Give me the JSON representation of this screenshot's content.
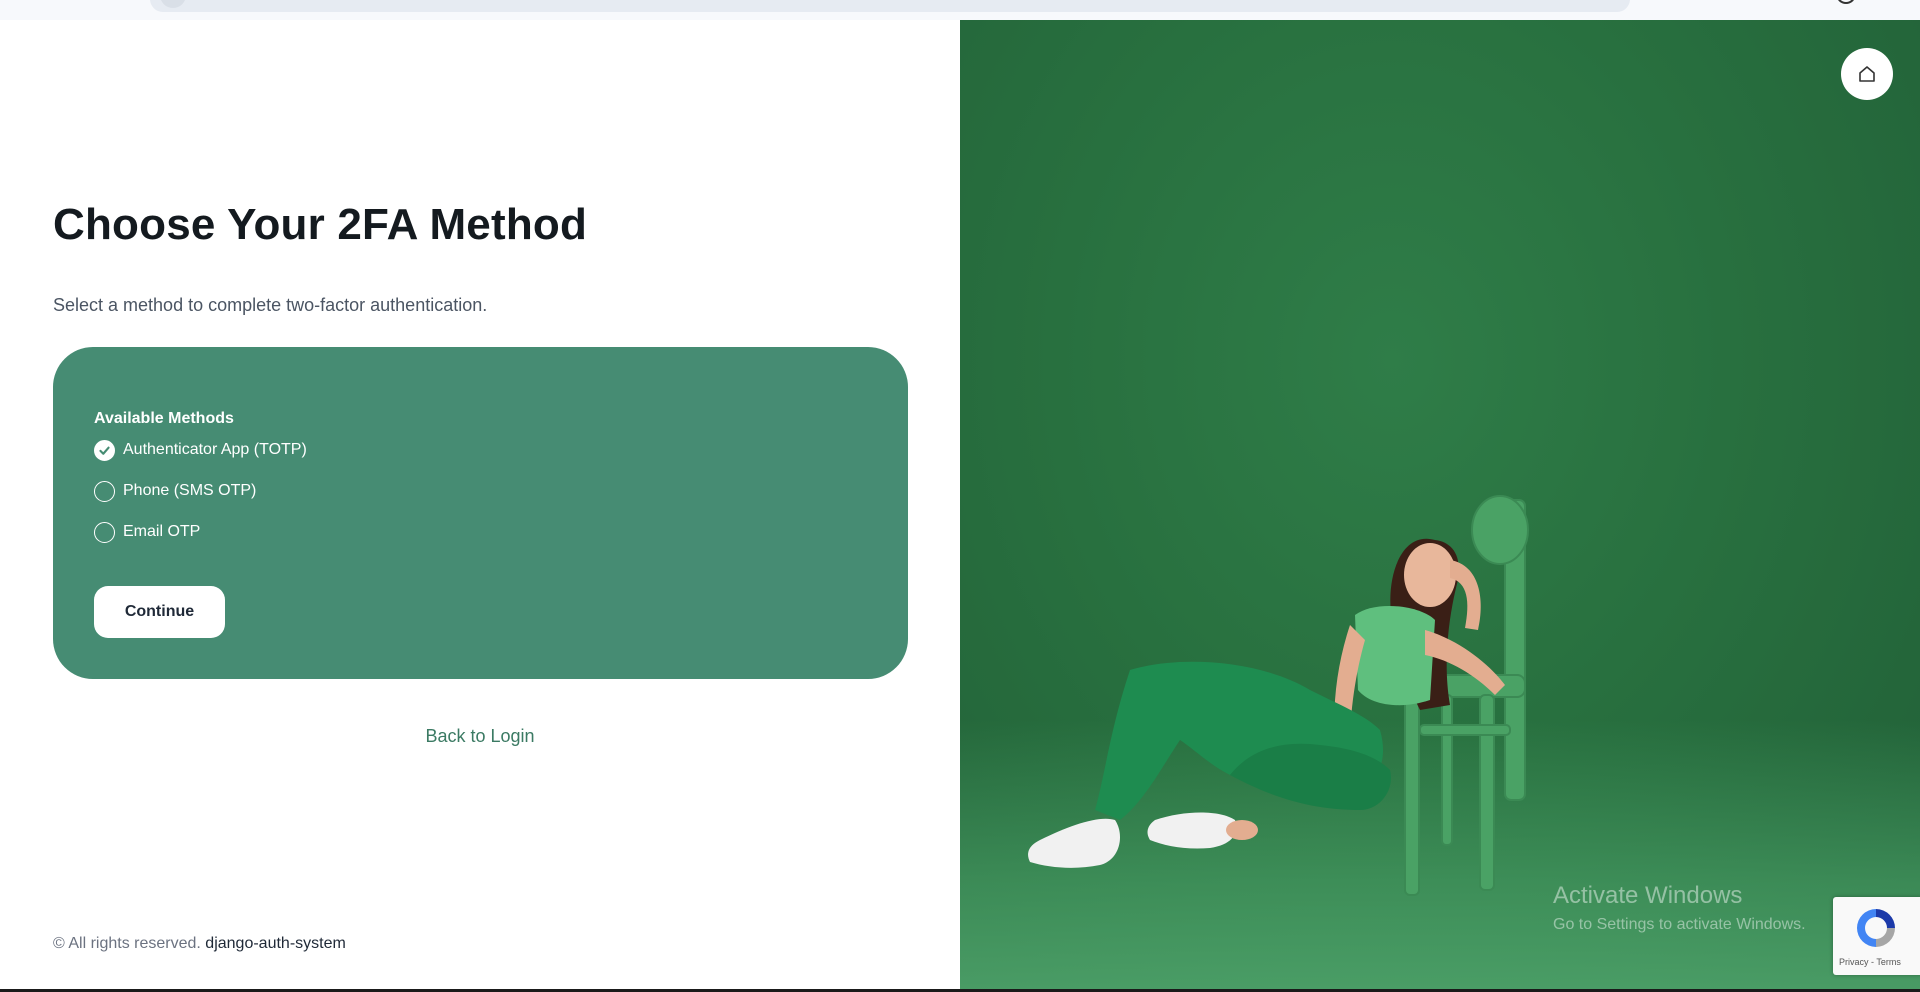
{
  "page": {
    "title": "Choose Your 2FA Method",
    "subtitle": "Select a method to complete two-factor authentication."
  },
  "methods": {
    "heading": "Available Methods",
    "options": [
      {
        "label": "Authenticator App (TOTP)",
        "checked": true
      },
      {
        "label": "Phone (SMS OTP)",
        "checked": false
      },
      {
        "label": "Email OTP",
        "checked": false
      }
    ],
    "continue_label": "Continue"
  },
  "links": {
    "back_to_login": "Back to Login"
  },
  "footer": {
    "copyright": "© All rights reserved.",
    "brand": "django-auth-system"
  },
  "hero": {
    "home_icon": "home-icon"
  },
  "overlays": {
    "watermark_title": "Activate Windows",
    "watermark_subtitle": "Go to Settings to activate Windows.",
    "recaptcha_links": "Privacy - Terms"
  },
  "colors": {
    "card": "#468c73",
    "hero_green": "#28703f",
    "link": "#3b7a63"
  }
}
